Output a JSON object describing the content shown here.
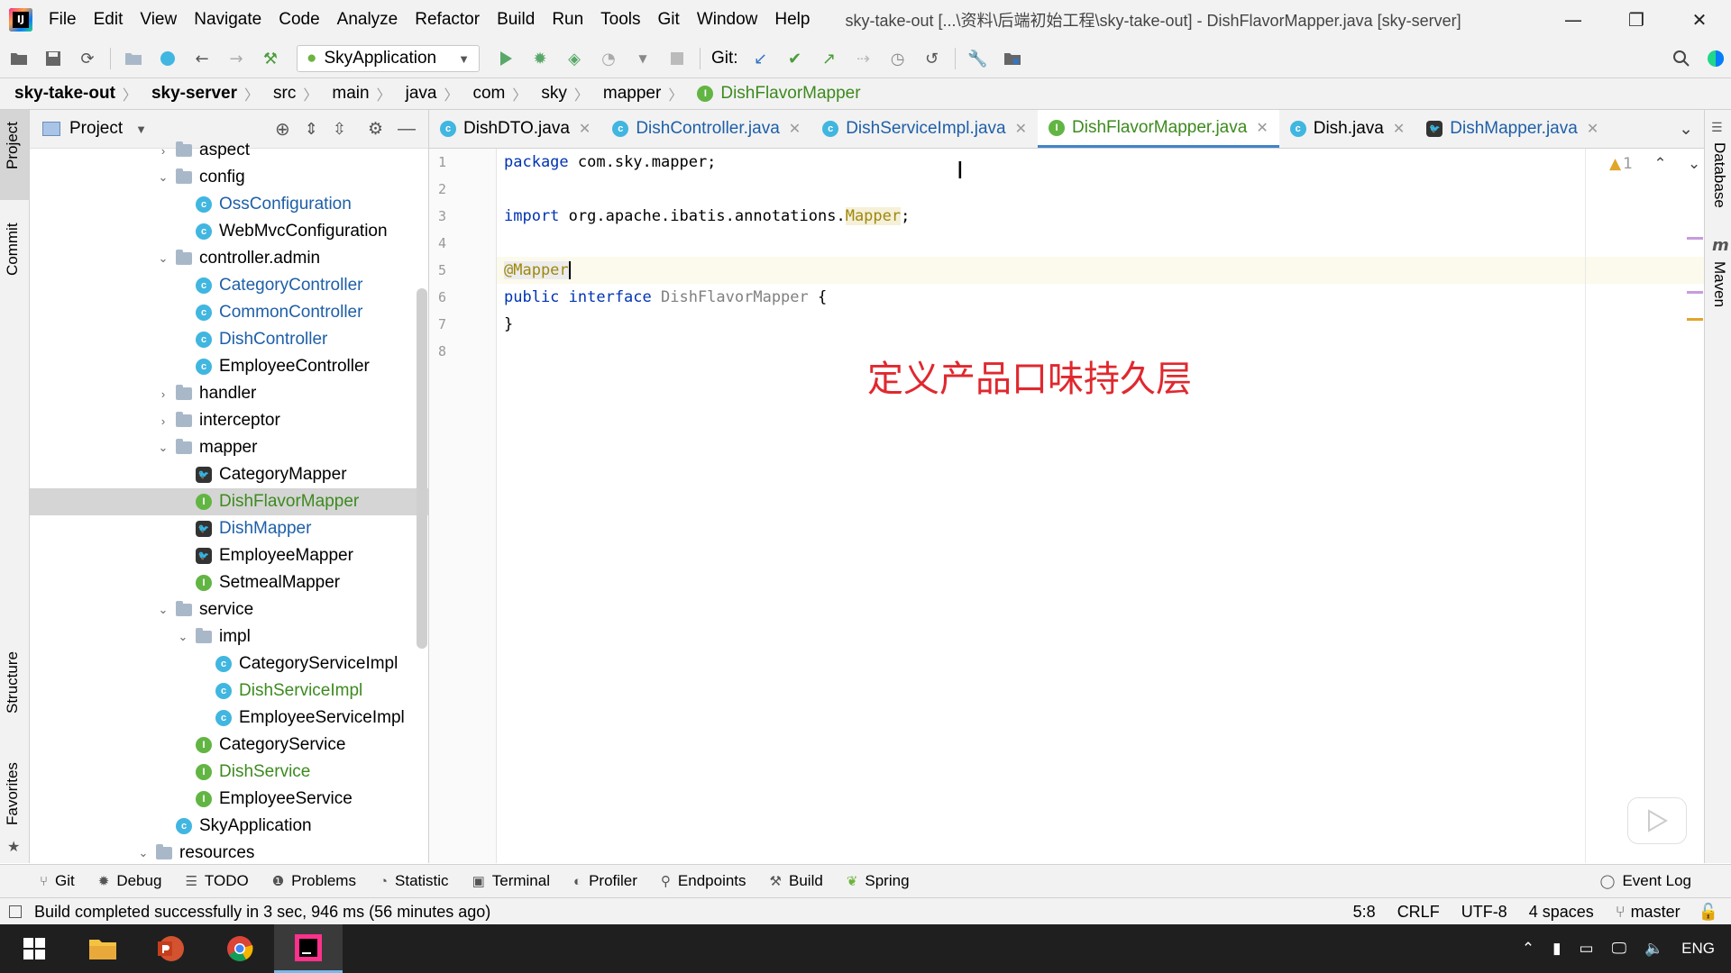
{
  "menu": [
    "File",
    "Edit",
    "View",
    "Navigate",
    "Code",
    "Analyze",
    "Refactor",
    "Build",
    "Run",
    "Tools",
    "Git",
    "Window",
    "Help"
  ],
  "window_title": "sky-take-out [...\\资料\\后端初始工程\\sky-take-out] - DishFlavorMapper.java [sky-server]",
  "toolbar": {
    "run_config": "SkyApplication",
    "git_label": "Git:"
  },
  "breadcrumb": [
    "sky-take-out",
    "sky-server",
    "src",
    "main",
    "java",
    "com",
    "sky",
    "mapper",
    "DishFlavorMapper"
  ],
  "left_strip": {
    "project": "Project",
    "commit": "Commit",
    "structure": "Structure",
    "favorites": "Favorites"
  },
  "right_strip": {
    "database": "Database",
    "maven": "Maven"
  },
  "project_panel": {
    "title": "Project",
    "tree": [
      {
        "label": "aspect",
        "type": "folder",
        "indent": 0,
        "expanded": false
      },
      {
        "label": "config",
        "type": "folder",
        "indent": 0,
        "expanded": true
      },
      {
        "label": "OssConfiguration",
        "type": "class",
        "indent": 1,
        "color": "blue"
      },
      {
        "label": "WebMvcConfiguration",
        "type": "class",
        "indent": 1,
        "color": "default"
      },
      {
        "label": "controller.admin",
        "type": "folder",
        "indent": 0,
        "expanded": true
      },
      {
        "label": "CategoryController",
        "type": "class",
        "indent": 1,
        "color": "blue"
      },
      {
        "label": "CommonController",
        "type": "class",
        "indent": 1,
        "color": "blue"
      },
      {
        "label": "DishController",
        "type": "class",
        "indent": 1,
        "color": "blue"
      },
      {
        "label": "EmployeeController",
        "type": "class",
        "indent": 1,
        "color": "default"
      },
      {
        "label": "handler",
        "type": "folder",
        "indent": 0,
        "expanded": false
      },
      {
        "label": "interceptor",
        "type": "folder",
        "indent": 0,
        "expanded": false
      },
      {
        "label": "mapper",
        "type": "folder",
        "indent": 0,
        "expanded": true
      },
      {
        "label": "CategoryMapper",
        "type": "mybatis",
        "indent": 1,
        "color": "default"
      },
      {
        "label": "DishFlavorMapper",
        "type": "interface",
        "indent": 1,
        "color": "green",
        "selected": true
      },
      {
        "label": "DishMapper",
        "type": "mybatis",
        "indent": 1,
        "color": "blue"
      },
      {
        "label": "EmployeeMapper",
        "type": "mybatis",
        "indent": 1,
        "color": "default"
      },
      {
        "label": "SetmealMapper",
        "type": "interface",
        "indent": 1,
        "color": "default"
      },
      {
        "label": "service",
        "type": "folder",
        "indent": 0,
        "expanded": true
      },
      {
        "label": "impl",
        "type": "folder",
        "indent": 1,
        "expanded": true
      },
      {
        "label": "CategoryServiceImpl",
        "type": "class",
        "indent": 2,
        "color": "default"
      },
      {
        "label": "DishServiceImpl",
        "type": "class",
        "indent": 2,
        "color": "green"
      },
      {
        "label": "EmployeeServiceImpl",
        "type": "class",
        "indent": 2,
        "color": "default"
      },
      {
        "label": "CategoryService",
        "type": "interface",
        "indent": 1,
        "color": "default"
      },
      {
        "label": "DishService",
        "type": "interface",
        "indent": 1,
        "color": "green"
      },
      {
        "label": "EmployeeService",
        "type": "interface",
        "indent": 1,
        "color": "default"
      },
      {
        "label": "SkyApplication",
        "type": "class",
        "indent": 0,
        "color": "default"
      },
      {
        "label": "resources",
        "type": "folder",
        "indent": -1,
        "expanded": true
      }
    ]
  },
  "tabs": [
    {
      "label": "DishDTO.java",
      "icon": "class"
    },
    {
      "label": "DishController.java",
      "icon": "class",
      "color": "blue"
    },
    {
      "label": "DishServiceImpl.java",
      "icon": "class",
      "color": "blue"
    },
    {
      "label": "DishFlavorMapper.java",
      "icon": "interface",
      "color": "green",
      "active": true
    },
    {
      "label": "Dish.java",
      "icon": "class"
    },
    {
      "label": "DishMapper.java",
      "icon": "mybatis",
      "color": "blue"
    }
  ],
  "code": {
    "line_numbers": [
      "1",
      "2",
      "3",
      "4",
      "5",
      "6",
      "7",
      "8"
    ],
    "l1_kw": "package",
    "l1_rest": " com.sky.mapper;",
    "l3_kw": "import",
    "l3_rest": " org.apache.ibatis.annotations.",
    "l3_ann": "Mapper",
    "l3_end": ";",
    "l5_ann": "@Mapper",
    "l6_kw": "public interface",
    "l6_name": " DishFlavorMapper",
    "l6_end": " {",
    "l7": "}"
  },
  "overlay_text": "定义产品口味持久层",
  "inspection_count": "1",
  "bottom_tools": [
    "Git",
    "Debug",
    "TODO",
    "Problems",
    "Statistic",
    "Terminal",
    "Profiler",
    "Endpoints",
    "Build",
    "Spring"
  ],
  "event_log": "Event Log",
  "status": {
    "message": "Build completed successfully in 3 sec, 946 ms (56 minutes ago)",
    "position": "5:8",
    "line_sep": "CRLF",
    "encoding": "UTF-8",
    "indent": "4 spaces",
    "branch": "master"
  },
  "taskbar": {
    "lang": "ENG"
  }
}
